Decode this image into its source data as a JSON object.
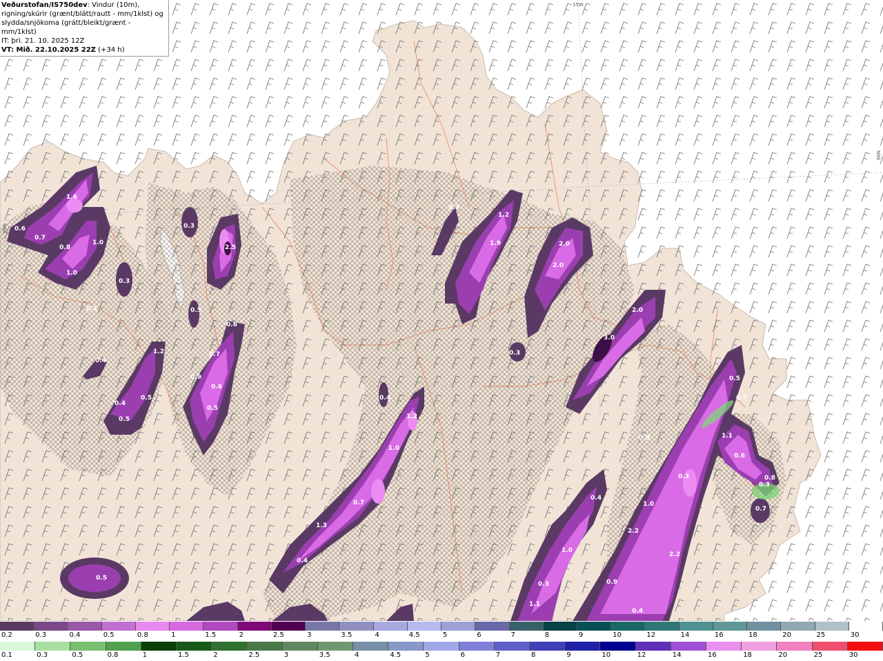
{
  "title": {
    "source": "Veðurstofan/IS750dev",
    "line1_rest": ": Vindur (10m),",
    "line2": "rigning/skúrir (grænt/blátt/rautt - mm/1klst) og",
    "line3": "slydda/snjókoma (grátt/bleikt/grænt - mm/1klst)",
    "it": "IT: þri. 21. 10. 2025 12Z",
    "vt": "VT: Mið. 22.10.2025 22Z",
    "lead": " (+34 h)"
  },
  "grid_labels": [
    "15W",
    "66N",
    "66N"
  ],
  "colors": {
    "sea": "#ffffff",
    "land": "#f1e4d7",
    "coast": "#c9b9ab",
    "roads": "#e2805c",
    "wind_barbs": "#6e6e6e",
    "precip_dark": "#5a3a64",
    "precip_mid": "#9b3fb0",
    "precip_light": "#d96be6",
    "precip_pink": "#ec8cf2"
  },
  "precip_values": [
    "1.6",
    "0.6",
    "0.7",
    "0.8",
    "1.0",
    "1.0",
    "0.3",
    "0.3",
    "0.5",
    "2.5",
    "0.3",
    "0.3",
    "1.2",
    "1.9",
    "2.0",
    "2.0",
    "2.0",
    "3.0",
    "0.3",
    "0.6",
    "0.7",
    "0.9",
    "0.6",
    "0.5",
    "0.4",
    "1.2",
    "0.4",
    "0.5",
    "0.5",
    "0.4",
    "1.2",
    "1.0",
    "0.7",
    "1.3",
    "0.4",
    "0.5",
    "0.5",
    "0.7",
    "1.1",
    "0.6",
    "0.8",
    "0.7",
    "0.3",
    "1.0",
    "2.2",
    "2.2",
    "0.9",
    "0.4",
    "0.3",
    "1.1",
    "0.8",
    "1.0",
    "0.4",
    "0.3"
  ],
  "legend_snow": {
    "labels": [
      "0.2",
      "0.3",
      "0.4",
      "0.5",
      "0.8",
      "1",
      "1.5",
      "2",
      "2.5",
      "3",
      "3.5",
      "4",
      "4.5",
      "5",
      "6",
      "7",
      "8",
      "9",
      "10",
      "12",
      "14",
      "16",
      "18",
      "20",
      "25",
      "30"
    ],
    "colors": [
      "#5a3a60",
      "#7a4888",
      "#9a58a8",
      "#c070d0",
      "#e888f0",
      "#d868e0",
      "#b048c0",
      "#800878",
      "#500050",
      "#7878a8",
      "#9090c0",
      "#a8a8e0",
      "#b8b8f0",
      "#a0a0d8",
      "#6868a8",
      "#386068",
      "#084048",
      "#085058",
      "#186868",
      "#307878",
      "#509090",
      "#609898",
      "#7090a0",
      "#90a8b0",
      "#b0c0c8",
      "#ffffff"
    ]
  },
  "legend_rain": {
    "labels": [
      "0.1",
      "0.3",
      "0.5",
      "0.8",
      "1",
      "1.5",
      "2",
      "2.5",
      "3",
      "3.5",
      "4",
      "4.5",
      "5",
      "6",
      "7",
      "8",
      "9",
      "10",
      "12",
      "14",
      "16",
      "18",
      "20",
      "25",
      "30"
    ],
    "colors": [
      "#d8f8d8",
      "#a8e0a0",
      "#78c070",
      "#50a050",
      "#084008",
      "#185818",
      "#307030",
      "#487848",
      "#608860",
      "#709870",
      "#7890a8",
      "#8898c8",
      "#a0a8e8",
      "#8080d8",
      "#6060c8",
      "#4040b8",
      "#2020a8",
      "#000090",
      "#6030b8",
      "#a050d8",
      "#e890f0",
      "#f0a0e0",
      "#f080c0",
      "#f05070",
      "#f01010"
    ]
  }
}
